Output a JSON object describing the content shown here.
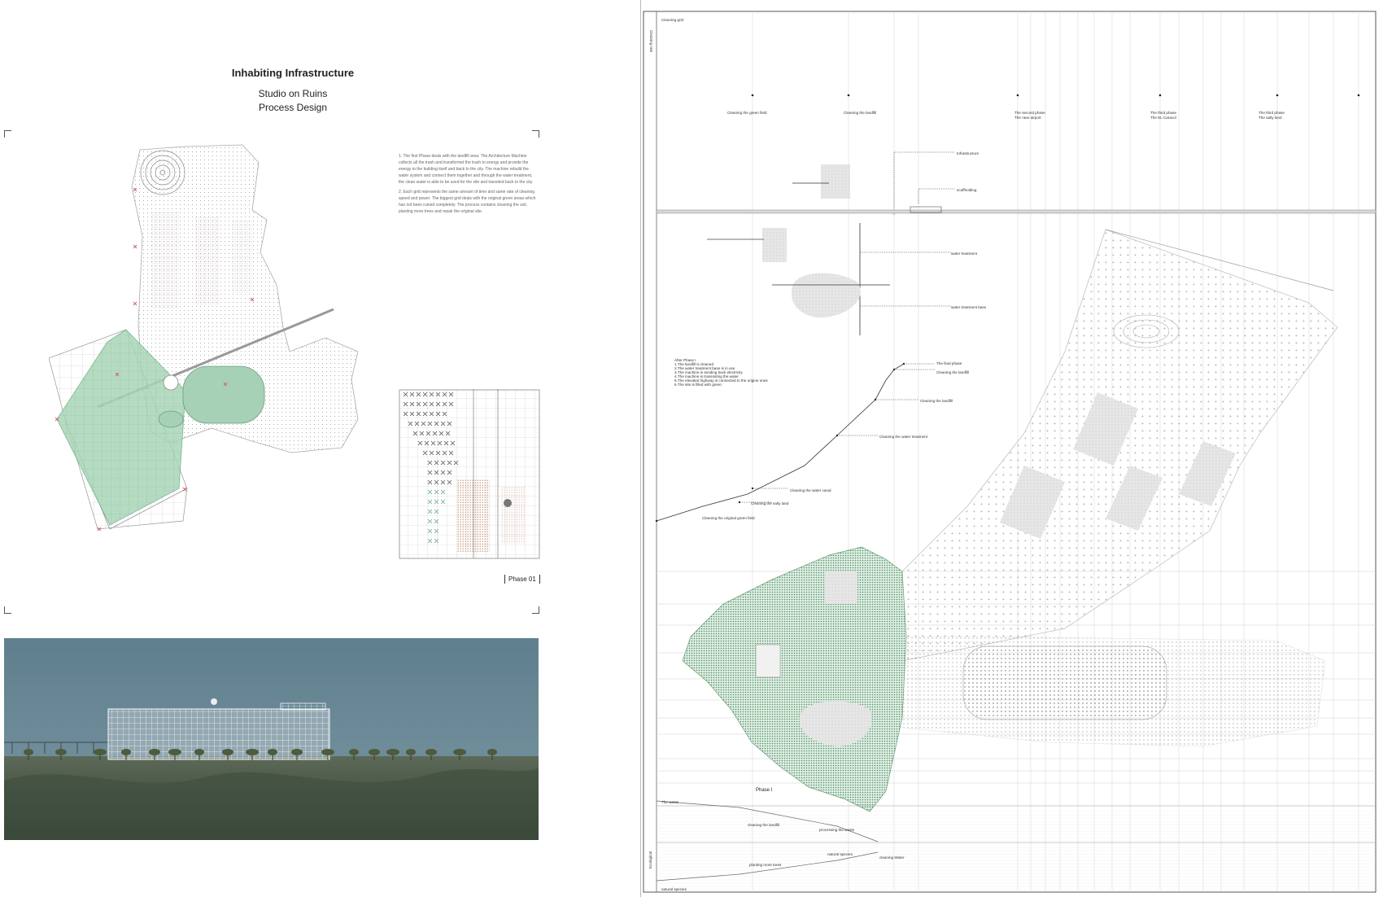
{
  "left_sheet": {
    "title": "Inhabiting Infrastructure",
    "subtitle_1": "Studio on Ruins",
    "subtitle_2": "Process Design",
    "description_p1": "1.  The first Phase deals with the landfill area. The Architecture Machine collects all the trash and transformet the trash to energy and provide the energy to the building itself and back to the city. The machine rebuild the water system and connect them together and through the water treatment, the clean water is able to be used for the site and transited back to the city.",
    "description_p2": "2.  Each grid represents the same amount of time and same rate of cleaning speed and power. The biggest grid deals with the original green areas which has not been ruined completely. The process contains cleaning the soil, planting more trees and repair the original site.",
    "phase_tag": "Phase 01",
    "colors": {
      "green": "#8fc8a3",
      "green_dark": "#5f9e78",
      "marker": "#d0637a",
      "brown": "#a0522d"
    }
  },
  "right_sheet": {
    "cleaning_grid_label": "Cleaning grid",
    "vertical_axis_label": "Cleaning rate",
    "phases": [
      {
        "label_1": "Cleaning the green field",
        "label_2": ""
      },
      {
        "label_1": "Cleaning the landfill",
        "label_2": ""
      },
      {
        "label_1": "The second phase",
        "label_2": "The near airport"
      },
      {
        "label_1": "The third phase",
        "label_2": "The EL Caracol"
      },
      {
        "label_1": "The third phase",
        "label_2": "The salty land"
      }
    ],
    "infrastructure_label": "Infrastructure",
    "scaffolding_label": "scaffholding",
    "water_treatment_label": "water treatment",
    "water_treatment_base_label": "water treatment base",
    "after_phase_title": "After Phase I",
    "after_phase_items": [
      "1.The landfill is cleaned",
      "2.The water treatment base is in use",
      "3.The machine is sending back electricity",
      "4.The machine is transmiting the water",
      "5.The elevated highway is connected to the origine ones",
      "6.The site is filled with green"
    ],
    "process_steps": [
      "The final phase",
      "Cleaning the landfill",
      "Cleaning the landfill",
      "Cleaning the water treatment",
      "Cleaning the water canal",
      "Cleaning the salty land",
      "Cleaning the original green field"
    ],
    "phase_label": "Phase I",
    "timeline": {
      "waste": "The waste",
      "cleaning_landfill": "cleaning the landfill",
      "processing_waste": "processing the waste",
      "natural_species": "natural species",
      "cleaning_water": "cleaning Water",
      "planting_trees": "planting more trees",
      "natural_species_bottom": "natural species",
      "vertical_label": "Ecological"
    }
  }
}
